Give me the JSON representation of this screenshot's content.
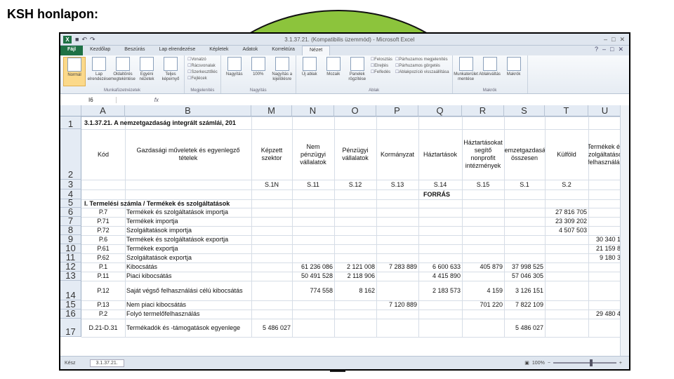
{
  "slide": {
    "title": "KSH honlapon:"
  },
  "excel": {
    "window_title": "3.1.37.21. (Kompatibilis üzemmód) - Microsoft Excel",
    "tabs": [
      "Fájl",
      "Kezdőlap",
      "Beszúrás",
      "Lap elrendezése",
      "Képletek",
      "Adatok",
      "Korrektúra",
      "Nézet"
    ],
    "active_tab": "Nézet",
    "ribbon": {
      "groups": [
        {
          "label": "Munkafüzetnézetek",
          "buttons": [
            "Normál",
            "Lap elrendezése",
            "Oldaltörés megtekintése",
            "Egyéni nézetek",
            "Teljes képernyő"
          ]
        },
        {
          "label": "Megjelenítés",
          "checks": [
            "Vonalzó",
            "Rácsvonalak",
            "Szerkesztőléc",
            "Fejlécek"
          ]
        },
        {
          "label": "Nagyítás",
          "buttons": [
            "Nagyítás",
            "100%",
            "Nagyítás a kijelölésre"
          ]
        },
        {
          "label": "Ablak",
          "buttons": [
            "Új ablak",
            "Mozaik",
            "Panelek rögzítése"
          ],
          "small": [
            "Felosztás",
            "Elrejtés",
            "Felfedés"
          ],
          "small2": [
            "Párhuzamos megjelenítés",
            "Párhuzamos görgetés",
            "Ablakpozíció visszaállítása"
          ]
        },
        {
          "label": "Makrók",
          "buttons": [
            "Munkaterület mentése",
            "Ablakváltás",
            "Makrók"
          ]
        }
      ]
    },
    "formula_bar": {
      "name_box": "I6",
      "fx": "fx",
      "value": ""
    },
    "columns": [
      "A",
      "B",
      "M",
      "N",
      "O",
      "P",
      "Q",
      "R",
      "S",
      "T",
      "U"
    ],
    "row_numbers": [
      "1",
      "2",
      "3",
      "4",
      "5",
      "6",
      "7",
      "8",
      "9",
      "10",
      "11",
      "12",
      "13",
      "14",
      "15",
      "16",
      "17"
    ],
    "sheet": {
      "title_cell": "3.1.37.21. A nemzetgazdaság integrált számlái, 201",
      "header": {
        "kod": "Kód",
        "muvelet": "Gazdasági műveletek és egyenlegző tételek",
        "cols": [
          "Nem pénzügyi vállalatok",
          "Pénzügyi vállalatok",
          "Kormányzat",
          "Háztartások",
          "Háztartásokat segítő nonprofit intézmények",
          "Nemzetgazdaság összesen",
          "Külföld",
          "Termékek és szolgáltatások (felhasználás)"
        ],
        "col_M": "Képzett szektor",
        "codes": [
          "S.1N",
          "S.11",
          "S.12",
          "S.13",
          "S.14",
          "S.15",
          "S.1",
          "S.2",
          "",
          ""
        ],
        "forras": "FORRÁS"
      },
      "rows": [
        {
          "a": "",
          "b": "I. Termelési számla / Termékek és szolgáltatások",
          "bold": true,
          "vals": [
            "",
            "",
            "",
            "",
            "",
            "",
            "",
            "",
            ""
          ]
        },
        {
          "a": "P.7",
          "b": "Termékek és szolgáltatások importja",
          "vals": [
            "",
            "",
            "",
            "",
            "",
            "",
            "",
            "27 816 705",
            ""
          ]
        },
        {
          "a": "P.71",
          "b": "Termékek importja",
          "vals": [
            "",
            "",
            "",
            "",
            "",
            "",
            "",
            "23 309 202",
            ""
          ]
        },
        {
          "a": "P.72",
          "b": "Szolgáltatások importja",
          "vals": [
            "",
            "",
            "",
            "",
            "",
            "",
            "",
            "4 507 503",
            ""
          ]
        },
        {
          "a": "P.6",
          "b": "Termékek és szolgáltatások exportja",
          "vals": [
            "",
            "",
            "",
            "",
            "",
            "",
            "",
            "",
            "30 340 1"
          ]
        },
        {
          "a": "P.61",
          "b": "Termékek exportja",
          "vals": [
            "",
            "",
            "",
            "",
            "",
            "",
            "",
            "",
            "21 159 8"
          ]
        },
        {
          "a": "P.62",
          "b": "Szolgáltatások exportja",
          "vals": [
            "",
            "",
            "",
            "",
            "",
            "",
            "",
            "",
            "9 180 3"
          ]
        },
        {
          "a": "P.1",
          "b": "Kibocsátás",
          "vals": [
            "",
            "61 236 086",
            "2 121 008",
            "7 283 889",
            "6 600 633",
            "405 879",
            "37 998 525",
            "",
            ""
          ]
        },
        {
          "a": "P.11",
          "b": "Piaci kibocsátás",
          "vals": [
            "",
            "50 491 528",
            "2 118 906",
            "",
            "4 415 890",
            "",
            "57 046 305",
            "",
            ""
          ]
        },
        {
          "a": "P.12",
          "b": "Saját végső felhasználási célú kibocsátás",
          "vals": [
            "",
            "774 558",
            "8 162",
            "",
            "2 183 573",
            "4 159",
            "3 126 151",
            "",
            ""
          ]
        },
        {
          "a": "P.13",
          "b": "Nem piaci kibocsátás",
          "vals": [
            "",
            "",
            "",
            "7 120 889",
            "",
            "701 220",
            "7 822 109",
            "",
            ""
          ]
        },
        {
          "a": "P.2",
          "b": "Folyó termelőfelhasználás",
          "vals": [
            "",
            "",
            "",
            "",
            "",
            "",
            "",
            "",
            "29 480 4"
          ]
        },
        {
          "a": "D.21-D.31",
          "b": "Termékadók és -támogatások egyenlege",
          "vals": [
            "5 486 027",
            "",
            "",
            "",
            "",
            "",
            "5 486 027",
            "",
            ""
          ]
        }
      ]
    },
    "status": {
      "ready": "Kész",
      "sheet_tab": "3.1.37.21.",
      "zoom": "100%"
    }
  }
}
